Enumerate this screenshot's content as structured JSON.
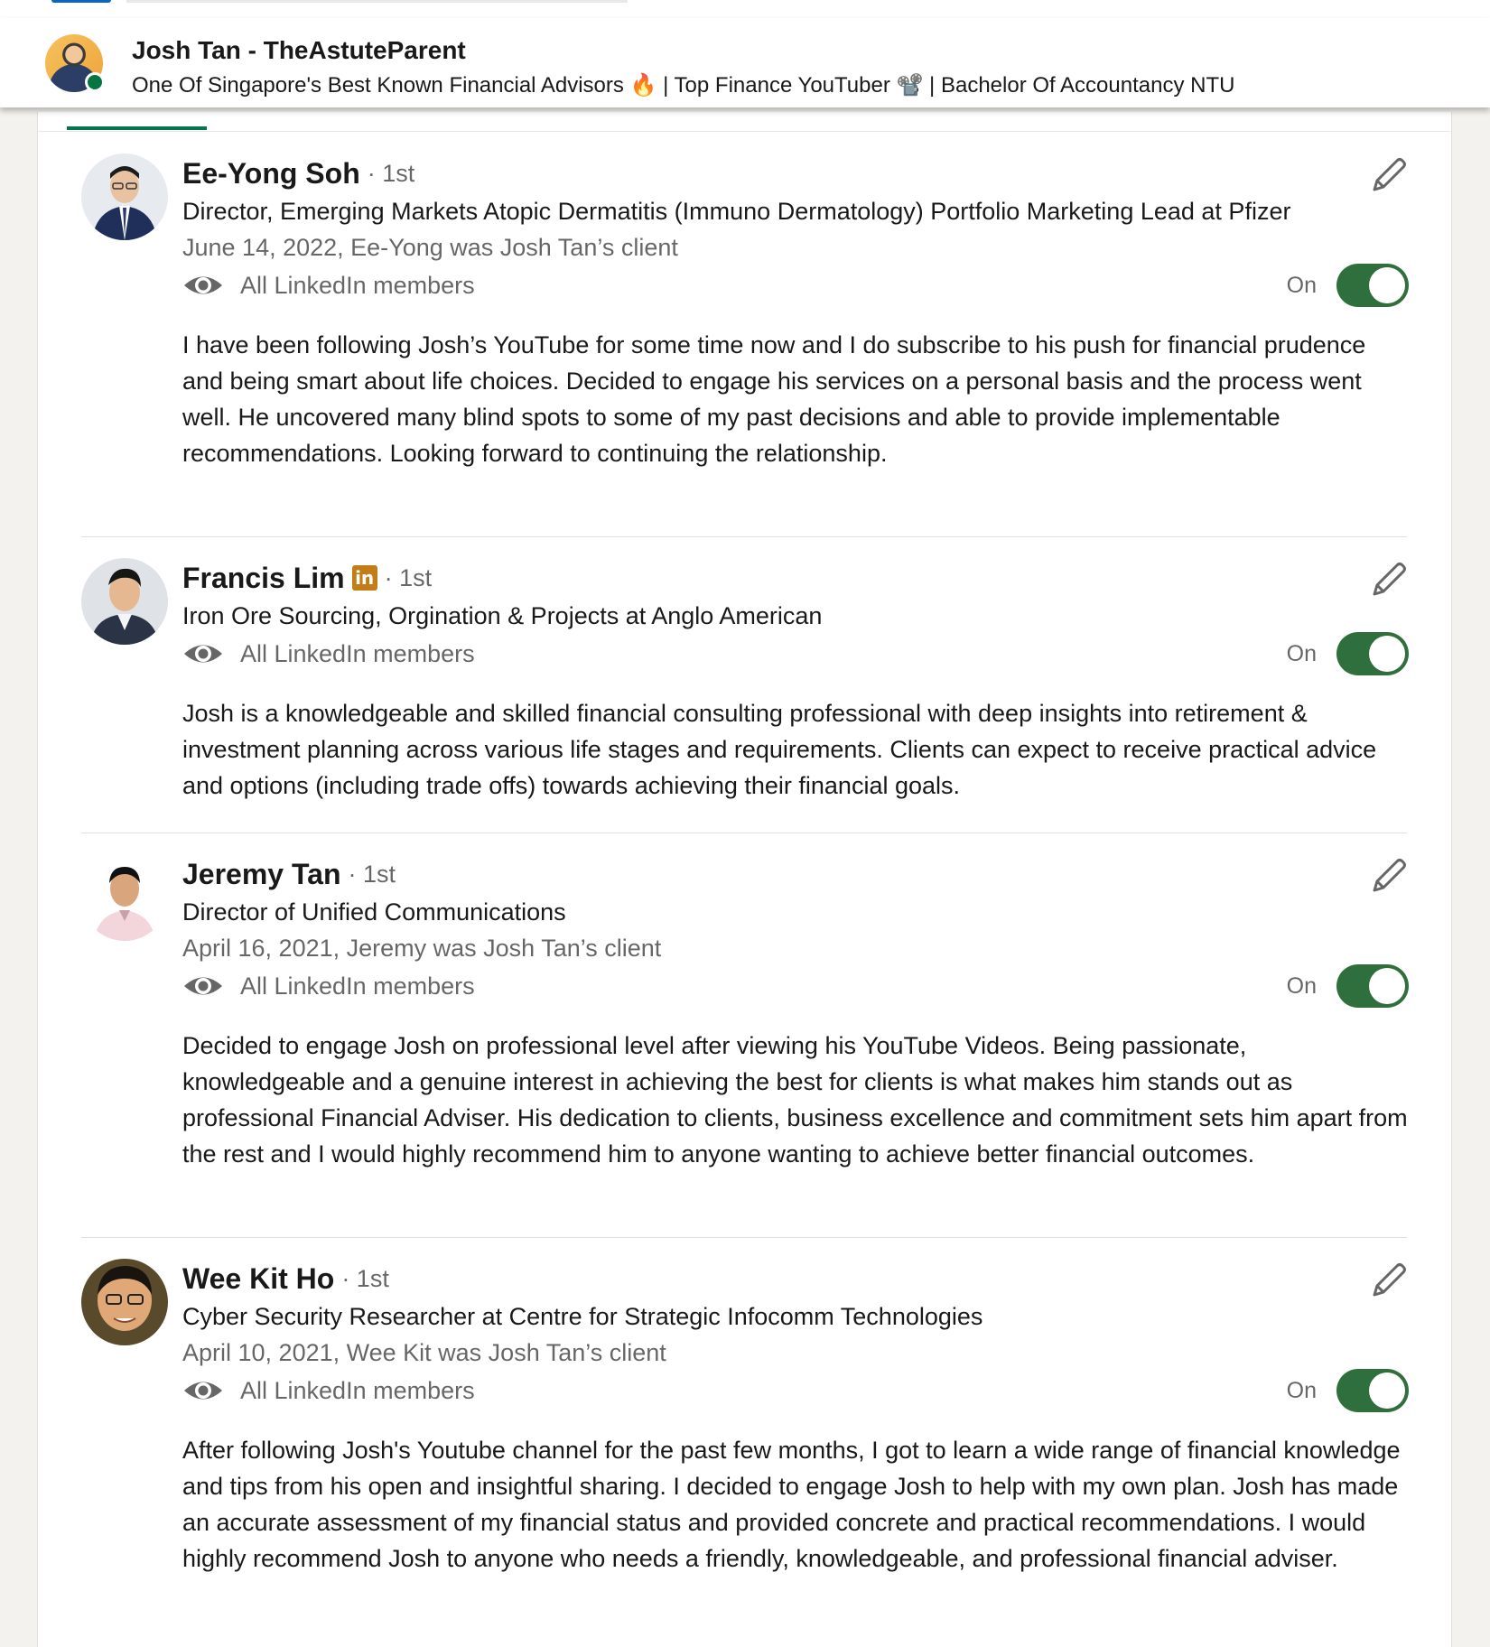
{
  "header": {
    "name": "Josh Tan - TheAstuteParent",
    "headline": "One Of Singapore's Best Known Financial Advisors 🔥 | Top Finance YouTuber 📽️ | Bachelor Of Accountancy NTU"
  },
  "colors": {
    "toggle_on": "#2f6f3e",
    "tab_indicator": "#01754f",
    "online": "#057642",
    "premium_badge": "#c37d16"
  },
  "recommendations": [
    {
      "name": "Ee-Yong Soh",
      "degree": "· 1st",
      "has_badge": false,
      "title": "Director, Emerging Markets Atopic Dermatitis (Immuno Dermatology) Portfolio Marketing Lead at Pfizer",
      "meta": "June 14, 2022, Ee-Yong was Josh Tan’s client",
      "visibility": "All LinkedIn members",
      "toggle_label": "On",
      "text": "I have been following Josh’s YouTube for some time now and I do subscribe to his push for financial prudence and being smart about life choices. Decided to engage his services on a personal basis and the process went well. He uncovered many blind spots to some of my past decisions and able to provide implementable recommendations. Looking forward to continuing the relationship."
    },
    {
      "name": "Francis Lim",
      "degree": "· 1st",
      "badge": "in",
      "title": "Iron Ore Sourcing, Orgination & Projects at Anglo American",
      "meta": "",
      "visibility": "All LinkedIn members",
      "toggle_label": "On",
      "text": "Josh is a knowledgeable and skilled financial consulting professional with deep insights into retirement & investment planning across various life stages and requirements. Clients can expect to receive practical advice and options (including trade offs) towards achieving their financial goals."
    },
    {
      "name": "Jeremy Tan",
      "degree": "· 1st",
      "title": "Director of Unified Communications",
      "meta": "April 16, 2021, Jeremy was Josh Tan’s client",
      "visibility": "All LinkedIn members",
      "toggle_label": "On",
      "text": "Decided to engage Josh on professional level after viewing his YouTube Videos. Being passionate, knowledgeable and a genuine interest in achieving the best for clients is what makes him stands out as professional Financial Adviser. His dedication to clients, business excellence and commitment sets him apart from the rest and I would highly recommend him to anyone wanting to achieve better financial outcomes."
    },
    {
      "name": "Wee Kit Ho",
      "degree": "· 1st",
      "title": "Cyber Security Researcher at Centre for Strategic Infocomm Technologies",
      "meta": "April 10, 2021, Wee Kit was Josh Tan’s client",
      "visibility": "All LinkedIn members",
      "toggle_label": "On",
      "text": "After following Josh's Youtube channel for the past few months, I got to learn a wide range of financial knowledge and tips from his open and insightful sharing. I decided to engage Josh to help with my own plan. Josh has made an accurate assessment of my financial status and provided concrete and practical recommendations. I would highly recommend Josh to anyone who needs a friendly, knowledgeable, and professional financial adviser."
    }
  ],
  "icons": {
    "edit": "pencil-icon",
    "visibility": "eye-icon",
    "premium": "linkedin-badge-icon"
  }
}
